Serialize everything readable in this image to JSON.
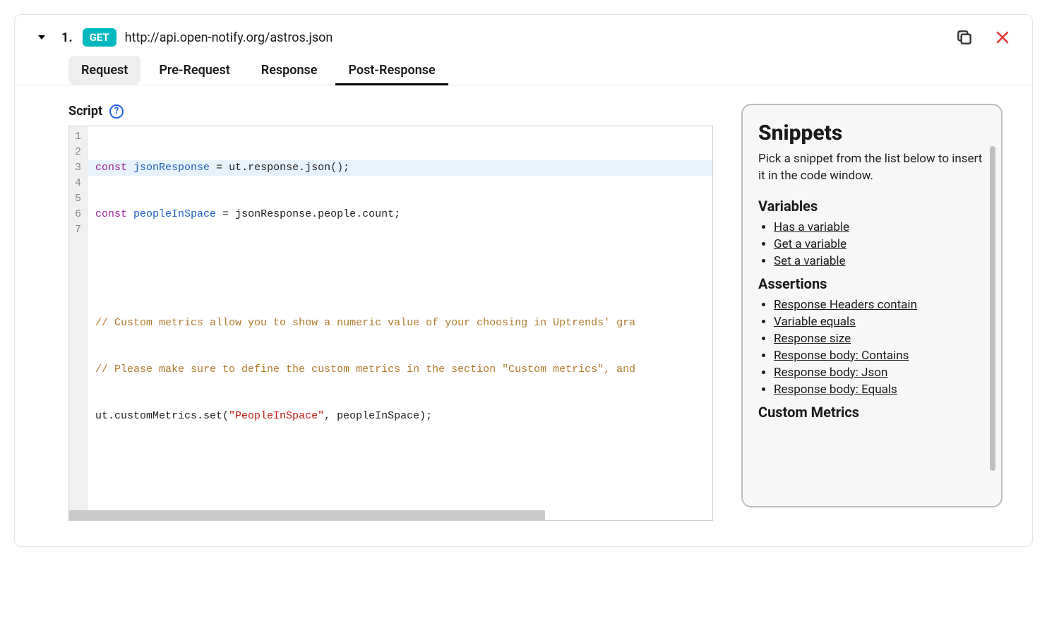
{
  "header": {
    "step_number": "1.",
    "method": "GET",
    "url": "http://api.open-notify.org/astros.json"
  },
  "tabs": {
    "request": "Request",
    "pre_request": "Pre-Request",
    "response": "Response",
    "post_response": "Post-Response",
    "active": "post_response"
  },
  "script": {
    "label": "Script",
    "help": "?",
    "line_numbers": [
      "1",
      "2",
      "3",
      "4",
      "5",
      "6",
      "7"
    ],
    "lines": {
      "l1_kw1": "const ",
      "l1_id": "jsonResponse",
      "l1_rest": " = ut.response.json();",
      "l2_kw1": "const ",
      "l2_id": "peopleInSpace",
      "l2_rest": " = jsonResponse.people.count;",
      "l3": "",
      "l4": "",
      "l5_cmt": "// Custom metrics allow you to show a numeric value of your choosing in Uptrends' gra",
      "l6_cmt": "// Please make sure to define the custom metrics in the section \"Custom metrics\", and",
      "l7_pre": "ut.customMetrics.set(",
      "l7_str": "\"PeopleInSpace\"",
      "l7_post": ", peopleInSpace);"
    }
  },
  "snippets": {
    "title": "Snippets",
    "description": "Pick a snippet from the list below to insert it in the code window.",
    "sections": {
      "variables": {
        "title": "Variables",
        "items": [
          "Has a variable",
          "Get a variable",
          "Set a variable"
        ]
      },
      "assertions": {
        "title": "Assertions",
        "items": [
          "Response Headers contain",
          "Variable equals",
          "Response size",
          "Response body: Contains",
          "Response body: Json",
          "Response body: Equals"
        ]
      },
      "custom_metrics": {
        "title": "Custom Metrics"
      }
    }
  }
}
